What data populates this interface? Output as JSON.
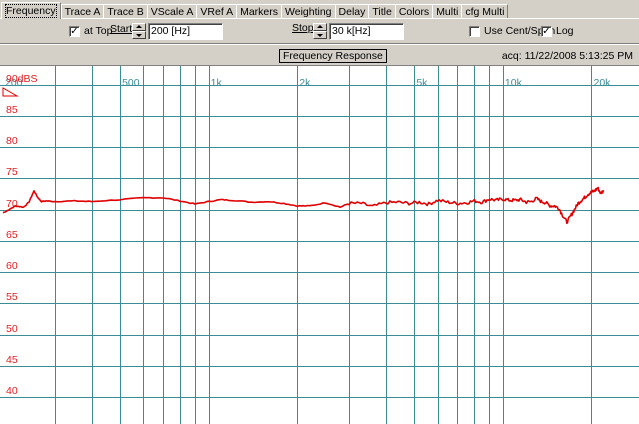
{
  "tabs": [
    {
      "label": "Frequency",
      "active": true
    },
    {
      "label": "Trace A"
    },
    {
      "label": "Trace B"
    },
    {
      "label": "VScale A"
    },
    {
      "label": "VRef A"
    },
    {
      "label": "Markers"
    },
    {
      "label": "Weighting"
    },
    {
      "label": "Delay"
    },
    {
      "label": "Title"
    },
    {
      "label": "Colors"
    },
    {
      "label": "Multi"
    },
    {
      "label": "cfg Multi"
    }
  ],
  "controls": {
    "at_top_label": "at Top",
    "at_top_checked": true,
    "start_label": "Start",
    "start_value": "200 [Hz]",
    "stop_label": "Stop",
    "stop_value": "30 k[Hz]",
    "use_cent_span_label": "Use Cent/Span",
    "use_cent_span_checked": false,
    "log_label": "Log",
    "log_checked": true
  },
  "chart_header": {
    "title": "Frequency Response",
    "acq_text": "acq: 11/22/2008 5:13:25 PM"
  },
  "chart_data": {
    "type": "line",
    "x_scale": "log",
    "xlim": [
      200,
      25000
    ],
    "ylim": [
      36,
      93
    ],
    "x_tick_labels": [
      {
        "value": 200,
        "label": "200"
      },
      {
        "value": 500,
        "label": "500"
      },
      {
        "value": 1000,
        "label": "1k"
      },
      {
        "value": 2000,
        "label": "2k"
      },
      {
        "value": 5000,
        "label": "5k"
      },
      {
        "value": 10000,
        "label": "10k"
      },
      {
        "value": 20000,
        "label": "20k"
      }
    ],
    "x_gridlines": [
      300,
      400,
      500,
      600,
      700,
      800,
      900,
      1000,
      2000,
      3000,
      4000,
      5000,
      6000,
      7000,
      8000,
      9000,
      10000,
      20000
    ],
    "y_tick_labels": [
      {
        "value": 90,
        "label": "90dBS"
      },
      {
        "value": 85,
        "label": "85"
      },
      {
        "value": 80,
        "label": "80"
      },
      {
        "value": 75,
        "label": "75"
      },
      {
        "value": 70,
        "label": "70"
      },
      {
        "value": 65,
        "label": "65"
      },
      {
        "value": 60,
        "label": "60"
      },
      {
        "value": 55,
        "label": "55"
      },
      {
        "value": 50,
        "label": "50"
      },
      {
        "value": 45,
        "label": "45"
      },
      {
        "value": 40,
        "label": "40"
      }
    ],
    "grid": true,
    "colors": {
      "background": "#ffffff",
      "grid": "#3c8c96",
      "trace": "#e00000",
      "y_labels": "#e02020",
      "x_labels": "#3c8c96"
    },
    "series": [
      {
        "color": "#e00000",
        "x": [
          200,
          210,
          220,
          235,
          245,
          255,
          262,
          270,
          280,
          300,
          350,
          400,
          500,
          600,
          700,
          800,
          900,
          1000,
          1100,
          1200,
          1400,
          1600,
          1800,
          2000,
          2200,
          2500,
          2800,
          3000,
          3300,
          3600,
          4000,
          4400,
          4800,
          5200,
          5600,
          6000,
          6500,
          7000,
          7500,
          8000,
          8500,
          9000,
          9500,
          10000,
          10500,
          11000,
          11500,
          12000,
          12500,
          13000,
          13500,
          14000,
          14500,
          15000,
          15500,
          16000,
          16500,
          17000,
          17500,
          18000,
          18500,
          19000,
          19500,
          20000,
          20500,
          21000,
          21500,
          22000
        ],
        "y": [
          69.5,
          70.0,
          70.6,
          70.4,
          71.2,
          73.0,
          72.0,
          71.3,
          71.4,
          71.3,
          71.4,
          71.3,
          71.6,
          71.9,
          71.9,
          71.4,
          70.9,
          71.3,
          71.6,
          71.5,
          71.2,
          71.3,
          71.0,
          70.6,
          70.6,
          71.1,
          70.4,
          71.0,
          71.0,
          70.5,
          71.1,
          71.2,
          71.0,
          71.2,
          70.9,
          71.5,
          71.2,
          71.0,
          71.1,
          71.4,
          71.2,
          71.7,
          71.5,
          71.7,
          71.5,
          71.5,
          71.6,
          71.2,
          71.3,
          71.8,
          71.3,
          71.1,
          70.6,
          70.6,
          70.2,
          69.0,
          68.0,
          69.0,
          70.0,
          71.0,
          71.5,
          72.0,
          72.5,
          72.8,
          73.0,
          73.5,
          72.6,
          73.1
        ]
      }
    ]
  }
}
